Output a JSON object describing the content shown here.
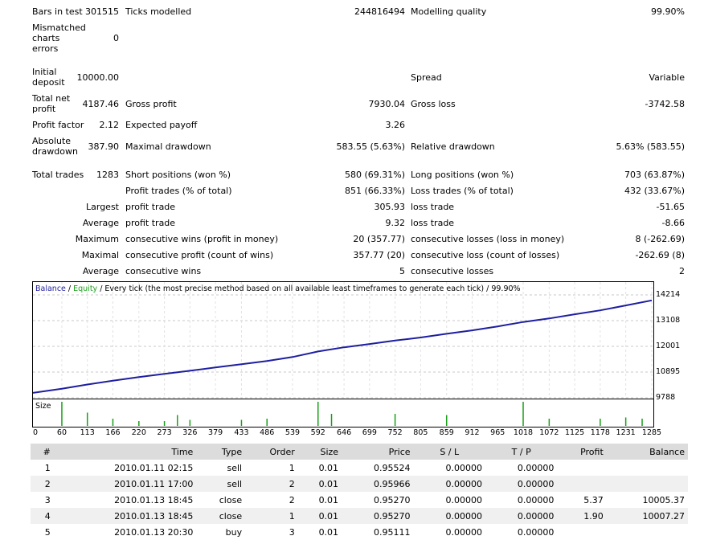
{
  "report": {
    "bars_in_test_label": "Bars in test",
    "bars_in_test": "301515",
    "ticks_modelled_label": "Ticks modelled",
    "ticks_modelled": "244816494",
    "modelling_quality_label": "Modelling quality",
    "modelling_quality": "99.90%",
    "mismatched_label": "Mismatched charts errors",
    "mismatched": "0",
    "initial_deposit_label": "Initial deposit",
    "initial_deposit": "10000.00",
    "spread_label": "Spread",
    "spread": "Variable",
    "total_net_profit_label": "Total net profit",
    "total_net_profit": "4187.46",
    "gross_profit_label": "Gross profit",
    "gross_profit": "7930.04",
    "gross_loss_label": "Gross loss",
    "gross_loss": "-3742.58",
    "profit_factor_label": "Profit factor",
    "profit_factor": "2.12",
    "expected_payoff_label": "Expected payoff",
    "expected_payoff": "3.26",
    "absolute_drawdown_label": "Absolute drawdown",
    "absolute_drawdown": "387.90",
    "maximal_drawdown_label": "Maximal drawdown",
    "maximal_drawdown": "583.55 (5.63%)",
    "relative_drawdown_label": "Relative drawdown",
    "relative_drawdown": "5.63% (583.55)",
    "total_trades_label": "Total trades",
    "total_trades": "1283",
    "short_positions_label": "Short positions (won %)",
    "short_positions": "580 (69.31%)",
    "long_positions_label": "Long positions (won %)",
    "long_positions": "703 (63.87%)",
    "profit_trades_label": "Profit trades (% of total)",
    "profit_trades": "851 (66.33%)",
    "loss_trades_label": "Loss trades (% of total)",
    "loss_trades": "432 (33.67%)",
    "largest_label": "Largest",
    "largest_profit_label": "profit trade",
    "largest_profit": "305.93",
    "largest_loss_label": "loss trade",
    "largest_loss": "-51.65",
    "average_label": "Average",
    "average_profit_label": "profit trade",
    "average_profit": "9.32",
    "average_loss_label": "loss trade",
    "average_loss": "-8.66",
    "maximum_label": "Maximum",
    "max_cons_wins_label": "consecutive wins (profit in money)",
    "max_cons_wins": "20 (357.77)",
    "max_cons_losses_label": "consecutive losses (loss in money)",
    "max_cons_losses": "8 (-262.69)",
    "maximal_label": "Maximal",
    "maximal_cons_profit_label": "consecutive profit (count of wins)",
    "maximal_cons_profit": "357.77 (20)",
    "maximal_cons_loss_label": "consecutive loss (count of losses)",
    "maximal_cons_loss": "-262.69 (8)",
    "average2_label": "Average",
    "avg_cons_wins_label": "consecutive wins",
    "avg_cons_wins": "5",
    "avg_cons_losses_label": "consecutive losses",
    "avg_cons_losses": "2"
  },
  "chart_data": {
    "type": "line",
    "legend": {
      "balance": "Balance",
      "sep1": " / ",
      "equity": "Equity",
      "rest": " / Every tick (the most precise method based on all available least timeframes to generate each tick) / 99.90%"
    },
    "y_ticks": [
      "14214",
      "13108",
      "12001",
      "10895",
      "9788"
    ],
    "x_ticks": [
      "0",
      "60",
      "113",
      "166",
      "220",
      "273",
      "326",
      "379",
      "433",
      "486",
      "539",
      "592",
      "646",
      "699",
      "752",
      "805",
      "859",
      "912",
      "965",
      "1018",
      "1072",
      "1125",
      "1178",
      "1231",
      "1285"
    ],
    "ylim": [
      9788,
      14214
    ],
    "xlim": [
      0,
      1285
    ],
    "series": [
      {
        "name": "Balance",
        "color": "#1e1ea0",
        "x": [
          0,
          60,
          113,
          166,
          220,
          273,
          326,
          379,
          433,
          486,
          539,
          592,
          646,
          699,
          752,
          805,
          859,
          912,
          965,
          1018,
          1072,
          1125,
          1178,
          1231,
          1285
        ],
        "values": [
          10000,
          10180,
          10360,
          10520,
          10680,
          10820,
          10950,
          11090,
          11230,
          11370,
          11540,
          11780,
          11960,
          12100,
          12250,
          12380,
          12540,
          12690,
          12860,
          13050,
          13200,
          13380,
          13550,
          13760,
          13980
        ]
      }
    ],
    "size_label": "Size",
    "size_spikes": [
      {
        "x": 60,
        "v": 1.0
      },
      {
        "x": 113,
        "v": 0.55
      },
      {
        "x": 166,
        "v": 0.3
      },
      {
        "x": 220,
        "v": 0.2
      },
      {
        "x": 273,
        "v": 0.2
      },
      {
        "x": 300,
        "v": 0.45
      },
      {
        "x": 326,
        "v": 0.25
      },
      {
        "x": 433,
        "v": 0.25
      },
      {
        "x": 486,
        "v": 0.3
      },
      {
        "x": 592,
        "v": 1.0
      },
      {
        "x": 620,
        "v": 0.5
      },
      {
        "x": 752,
        "v": 0.5
      },
      {
        "x": 859,
        "v": 0.45
      },
      {
        "x": 1018,
        "v": 1.0
      },
      {
        "x": 1072,
        "v": 0.3
      },
      {
        "x": 1178,
        "v": 0.3
      },
      {
        "x": 1231,
        "v": 0.35
      },
      {
        "x": 1265,
        "v": 0.3
      }
    ]
  },
  "trades_table": {
    "headers": [
      "#",
      "Time",
      "Type",
      "Order",
      "Size",
      "Price",
      "S / L",
      "T / P",
      "Profit",
      "Balance"
    ],
    "rows": [
      [
        "1",
        "2010.01.11 02:15",
        "sell",
        "1",
        "0.01",
        "0.95524",
        "0.00000",
        "0.00000",
        "",
        ""
      ],
      [
        "2",
        "2010.01.11 17:00",
        "sell",
        "2",
        "0.01",
        "0.95966",
        "0.00000",
        "0.00000",
        "",
        ""
      ],
      [
        "3",
        "2010.01.13 18:45",
        "close",
        "2",
        "0.01",
        "0.95270",
        "0.00000",
        "0.00000",
        "5.37",
        "10005.37"
      ],
      [
        "4",
        "2010.01.13 18:45",
        "close",
        "1",
        "0.01",
        "0.95270",
        "0.00000",
        "0.00000",
        "1.90",
        "10007.27"
      ],
      [
        "5",
        "2010.01.13 20:30",
        "buy",
        "3",
        "0.01",
        "0.95111",
        "0.00000",
        "0.00000",
        "",
        ""
      ]
    ]
  }
}
